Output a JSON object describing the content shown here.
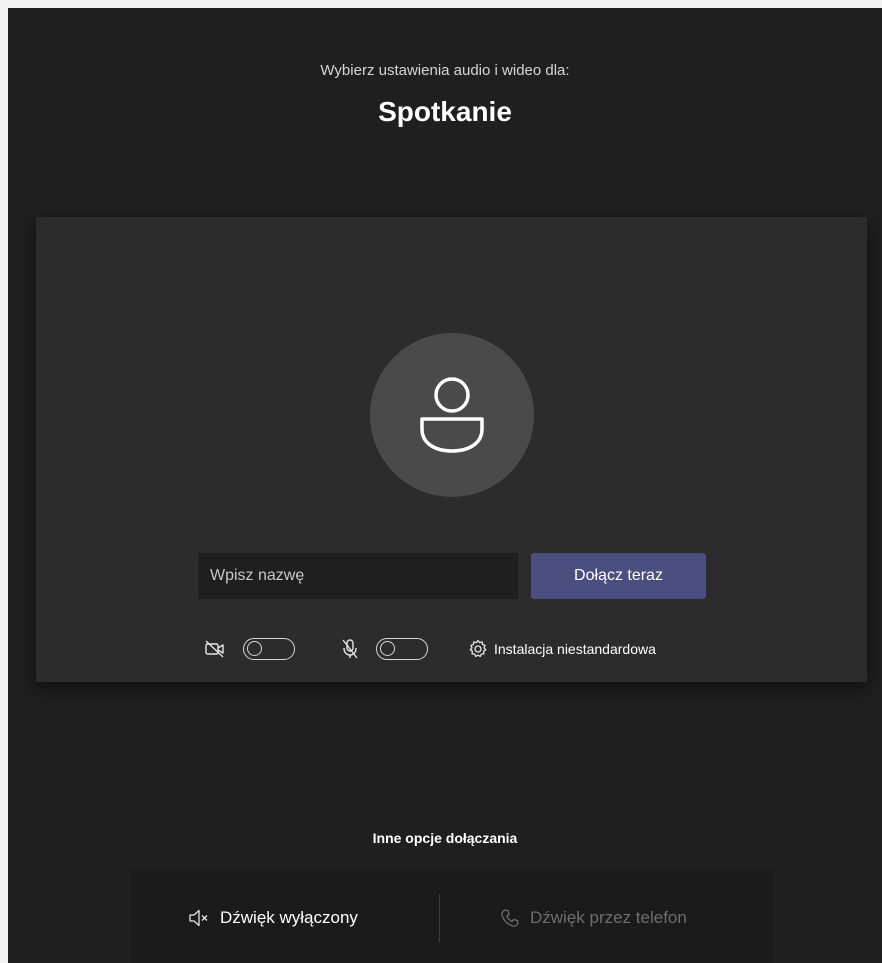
{
  "header": {
    "subtitle": "Wybierz ustawienia audio i wideo dla:",
    "title": "Spotkanie"
  },
  "preview": {
    "avatar_icon": "person-icon",
    "name_placeholder": "Wpisz nazwę",
    "name_value": "",
    "join_button": "Dołącz teraz",
    "video_toggle": {
      "icon": "camera-off-icon",
      "on": false
    },
    "mic_toggle": {
      "icon": "mic-off-icon",
      "on": false
    },
    "custom_setup": {
      "icon": "gear-icon",
      "label": "Instalacja niestandardowa"
    }
  },
  "other_options": {
    "title": "Inne opcje dołączania",
    "audio_off": {
      "icon": "speaker-off-icon",
      "label": "Dźwięk wyłączony"
    },
    "phone_audio": {
      "icon": "phone-icon",
      "label": "Dźwięk przez telefon"
    }
  },
  "colors": {
    "background": "#1f1f1f",
    "panel": "#2d2c2c",
    "accent": "#4b4f7f",
    "disabled_text": "#6e6e6e"
  }
}
